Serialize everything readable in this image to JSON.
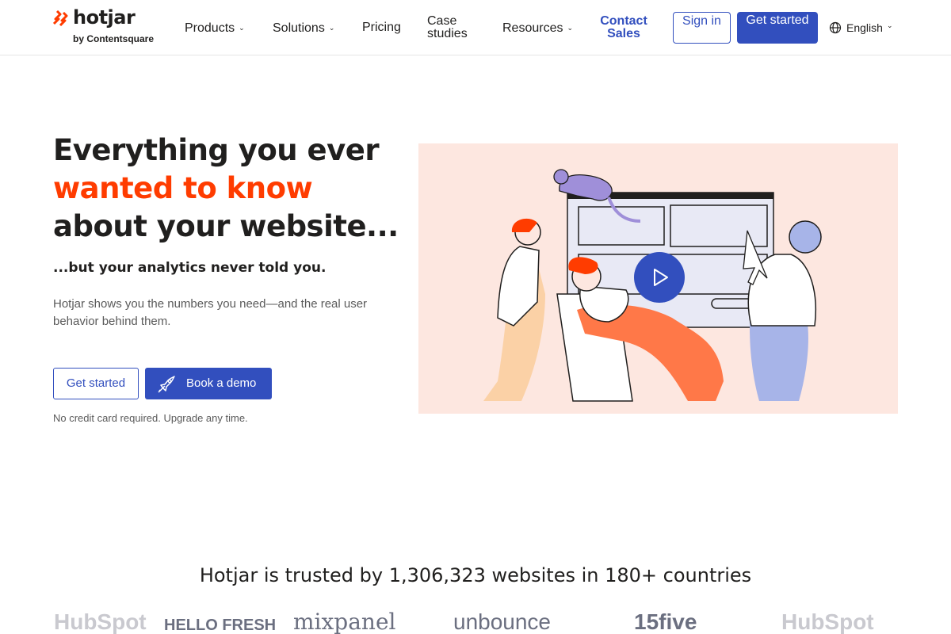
{
  "brand": {
    "name": "hotjar",
    "sub": "by Contentsquare",
    "accent": "#ff3c00",
    "primary": "#324fbe"
  },
  "nav": {
    "items": [
      {
        "label": "Products",
        "has_dropdown": true
      },
      {
        "label": "Solutions",
        "has_dropdown": true
      },
      {
        "label": "Pricing",
        "has_dropdown": false
      },
      {
        "label": "Case studies",
        "has_dropdown": false
      },
      {
        "label": "Resources",
        "has_dropdown": true
      }
    ],
    "contact": "Contact Sales",
    "sign_in": "Sign in",
    "get_started": "Get started",
    "language": "English"
  },
  "hero": {
    "title_line1": "Everything you ever",
    "title_accent": "wanted to know",
    "title_rest": " about your website...",
    "subtitle": "...but your analytics never told you.",
    "description": "Hotjar shows you the numbers you need—and the real user behavior behind them.",
    "cta_primary": "Get started",
    "cta_demo": "Book a demo",
    "note": "No credit card required. Upgrade any time."
  },
  "trusted": {
    "heading": "Hotjar is trusted by 1,306,323 websites in 180+ countries",
    "logos": [
      "HubSpot",
      "HELLO FRESH",
      "mixpanel",
      "unbounce",
      "15five",
      "HubSpot"
    ]
  }
}
